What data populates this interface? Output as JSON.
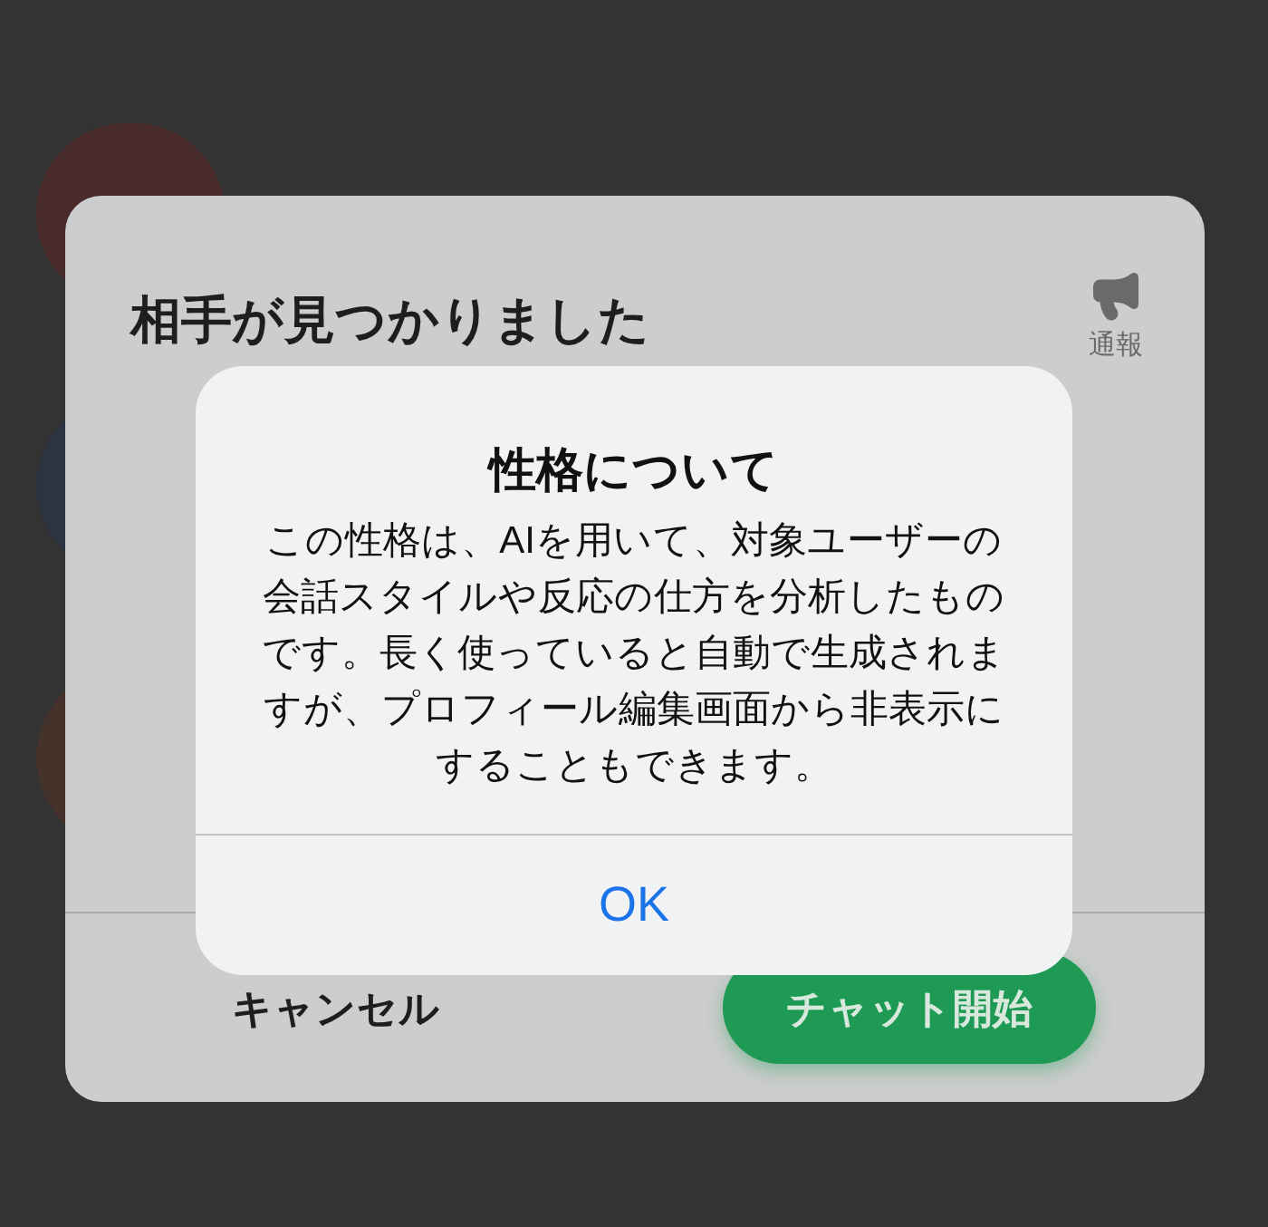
{
  "background_list": [
    {
      "color": "#4a2b2b"
    },
    {
      "color": "#2b3440"
    },
    {
      "color": "#45332b"
    }
  ],
  "match_card": {
    "title": "相手が見つかりました",
    "report_label": "通報",
    "cancel_button": "キャンセル",
    "start_button": "チャット開始"
  },
  "alert": {
    "title": "性格について",
    "message": "この性格は、AIを用いて、対象ユーザーの会話スタイルや反応の仕方を分析したものです。長く使っていると自動で生成されますが、プロフィール編集画面から非表示にすることもできます。",
    "button": "OK"
  }
}
